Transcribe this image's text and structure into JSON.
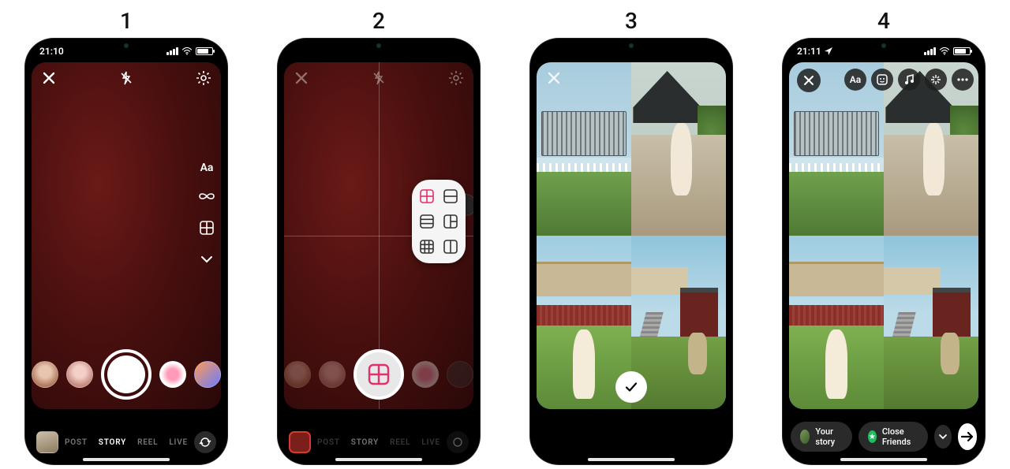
{
  "steps": [
    "1",
    "2",
    "3",
    "4"
  ],
  "status": {
    "time_a": "21:10",
    "time_b": "21:11"
  },
  "camera": {
    "side_tools": {
      "text_label": "Aa"
    },
    "modes": {
      "post": "POST",
      "story": "STORY",
      "reel": "REEL",
      "live": "LIVE",
      "active": "STORY"
    }
  },
  "layout_picker": {
    "options": [
      "grid-2x2",
      "rows-2",
      "rows-3",
      "col-split",
      "grid-3x3",
      "halves-v"
    ],
    "active": "grid-2x2"
  },
  "share": {
    "your_story": "Your story",
    "close_friends": "Close Friends"
  },
  "icons": {
    "close": "close-icon",
    "flash_off": "flash-off-icon",
    "settings": "settings-gear-icon",
    "infinity": "boomerang-infinity-icon",
    "layout": "layout-grid-icon",
    "chevron_down": "chevron-down-icon",
    "flip": "camera-flip-icon",
    "check": "check-icon",
    "text_tool": "text-tool-icon",
    "sticker": "sticker-icon",
    "music": "music-icon",
    "effects": "sparkle-effects-icon",
    "more": "more-ellipsis-icon",
    "send": "send-arrow-icon",
    "star": "star-icon",
    "location": "location-arrow-icon"
  }
}
